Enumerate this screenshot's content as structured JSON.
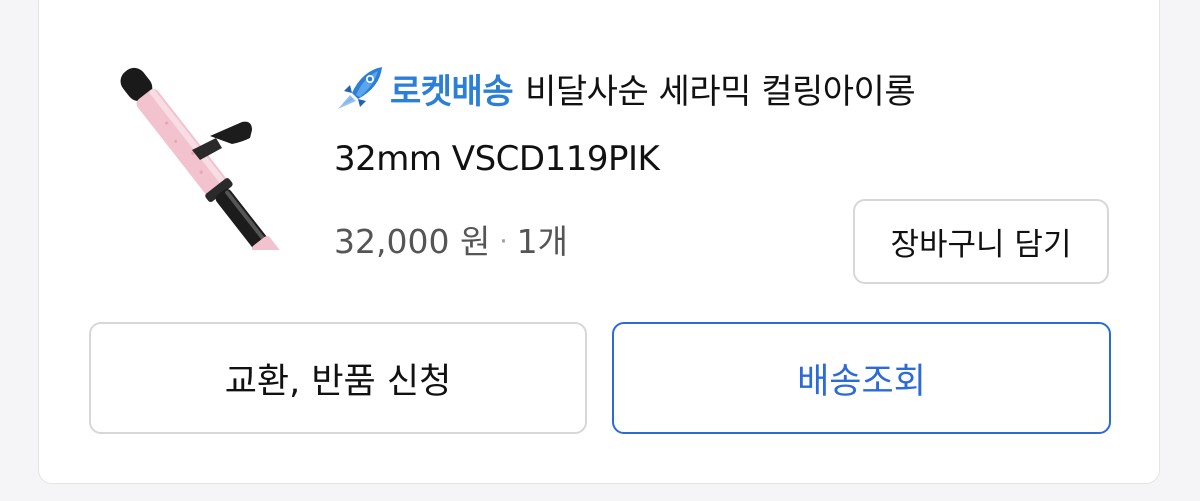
{
  "order_item": {
    "delivery_badge": {
      "label": "로켓배송",
      "icon": "rocket-icon",
      "color": "#2b7fd6"
    },
    "title_line1": "비달사순 세라믹 컬링아이롱",
    "title_line2": "32mm VSCD119PIK",
    "price": "32,000 원",
    "separator": "·",
    "quantity": "1개",
    "image_icon": "curling-iron-image"
  },
  "actions": {
    "add_to_cart_label": "장바구니 담기",
    "return_exchange_label": "교환, 반품 신청",
    "track_delivery_label": "배송조회",
    "track_delivery_color": "#2b6ad9"
  }
}
